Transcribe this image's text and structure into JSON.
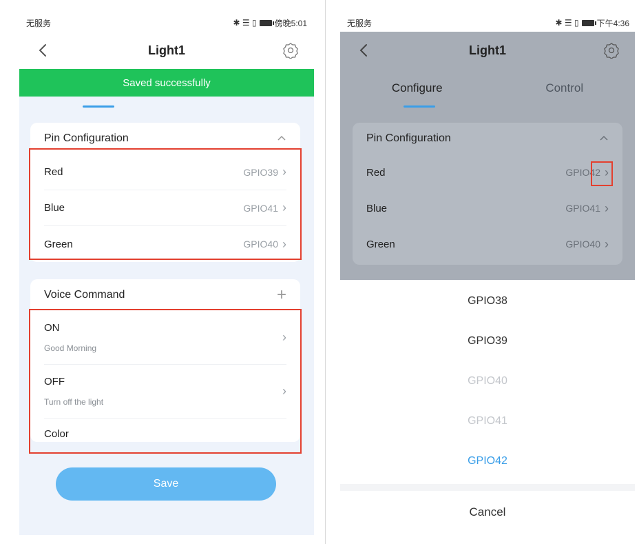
{
  "left": {
    "status": {
      "carrier": "无服务",
      "icons": "✱ ☰ ▯",
      "time": "傍晚5:01"
    },
    "title": "Light1",
    "toast": "Saved successfully",
    "pin_config": {
      "header": "Pin Configuration",
      "rows": [
        {
          "label": "Red",
          "value": "GPIO39"
        },
        {
          "label": "Blue",
          "value": "GPIO41"
        },
        {
          "label": "Green",
          "value": "GPIO40"
        }
      ]
    },
    "voice": {
      "header": "Voice Command",
      "add": "+",
      "items": [
        {
          "title": "ON",
          "subtitle": "Good Morning"
        },
        {
          "title": "OFF",
          "subtitle": "Turn off the light"
        },
        {
          "title": "Color",
          "subtitle": ""
        }
      ]
    },
    "save_label": "Save"
  },
  "right": {
    "status": {
      "carrier": "无服务",
      "icons": "✱ ☰ ▯",
      "time": "下午4:36"
    },
    "title": "Light1",
    "tabs": [
      {
        "label": "Configure"
      },
      {
        "label": "Control"
      }
    ],
    "pin_config": {
      "header": "Pin Configuration",
      "rows": [
        {
          "label": "Red",
          "value": "GPIO42"
        },
        {
          "label": "Blue",
          "value": "GPIO41"
        },
        {
          "label": "Green",
          "value": "GPIO40"
        }
      ]
    },
    "picker": {
      "options": [
        "GPIO38",
        "GPIO39",
        "GPIO40",
        "GPIO41",
        "GPIO42"
      ],
      "selected": "GPIO42",
      "cancel": "Cancel"
    }
  },
  "colors": {
    "accent": "#3a9ee8",
    "toast": "#1fc35a",
    "highlight": "#e3402f",
    "save": "#63b8f2"
  }
}
